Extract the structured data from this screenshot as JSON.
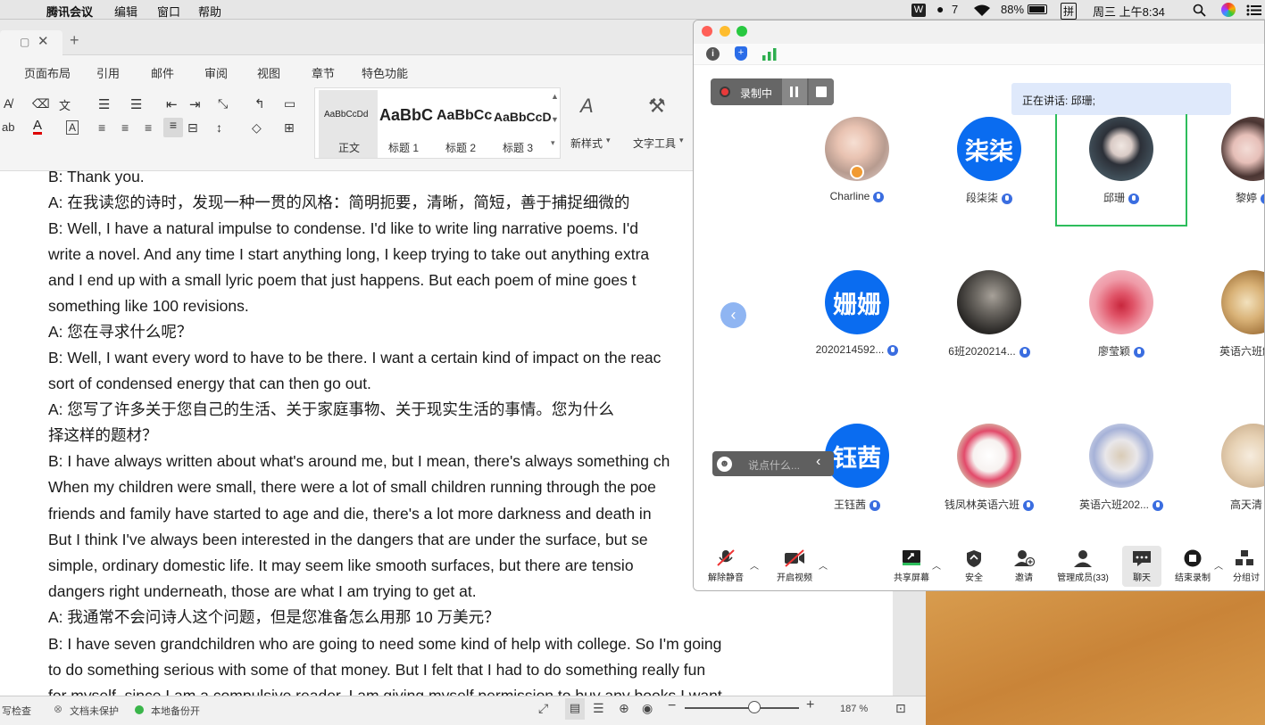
{
  "menubar": {
    "app_name": "腾讯会议",
    "menus": [
      "编辑",
      "窗口",
      "帮助"
    ],
    "notif_count": "7",
    "battery": "88%",
    "input_method": "拼",
    "datetime": "周三 上午8:34"
  },
  "word": {
    "ribbon_tabs": [
      "页面布局",
      "引用",
      "邮件",
      "审阅",
      "视图",
      "章节",
      "特色功能"
    ],
    "styles": [
      {
        "preview": "AaBbCcDd",
        "name": "正文"
      },
      {
        "preview": "AaBbC",
        "name": "标题 1"
      },
      {
        "preview": "AaBbCc",
        "name": "标题 2"
      },
      {
        "preview": "AaBbCcD",
        "name": "标题 3"
      }
    ],
    "new_style_label": "新样式",
    "text_tool_label": "文字工具",
    "doc_lines": [
      "B: Thank you.",
      "A:  在我读您的诗时，发现一种一贯的风格：简明扼要，清晰，简短，善于捕捉细微的",
      "B: Well, I have a natural impulse to condense. I'd like to write ling narrative poems. I'd",
      "write a novel. And any time I start anything long, I keep trying to take out anything extra",
      "and I end up with a small lyric poem that just happens. But each poem of mine goes t",
      "something like 100 revisions.",
      "A:  您在寻求什么呢？",
      "B: Well, I want every word to have to be there. I want a certain kind of impact on the reac",
      "sort of condensed energy that can then go out.",
      "A:  您写了许多关于您自己的生活、关于家庭事物、关于现实生活的事情。您为什么",
      "择这样的题材？",
      "B: I have always written about what's around me, but I mean, there's always something ch",
      "When my children were small, there were a lot of small children running through the poe",
      "friends and family have started to age and die, there's a lot more darkness and death in",
      "But I think I've always been interested in the dangers that are under the surface, but se",
      "simple, ordinary domestic life. It may seem like smooth surfaces, but there are tensio",
      "dangers right underneath, those are what I am trying to get at.",
      "A:  我通常不会问诗人这个问题，但是您准备怎么用那 10 万美元？",
      "B: I have seven grandchildren who are going to need some kind of help with college. So I'm going",
      "to do something serious with some of that money. But I felt that I had to do something really fun",
      "for myself, since I am a compulsive reader, I am giving myself permission to buy any books I want"
    ],
    "status": {
      "spell": "写检查",
      "protect": "文档未保护",
      "backup": "本地备份开",
      "zoom": "187 %"
    }
  },
  "meeting": {
    "recording_label": "录制中",
    "speaking_label": "正在讲话: 邱珊;",
    "chat_placeholder": "说点什么...",
    "participants": [
      {
        "name": "Charline",
        "avatar": "photo"
      },
      {
        "name": "段柒柒",
        "avatar": "text",
        "text": "柒柒"
      },
      {
        "name": "邱珊",
        "avatar": "photo",
        "active": true
      },
      {
        "name": "黎婷",
        "avatar": "photo"
      },
      {
        "name": "2020214592...",
        "avatar": "text",
        "text": "姗姗"
      },
      {
        "name": "6班2020214...",
        "avatar": "photo"
      },
      {
        "name": "廖莹颖",
        "avatar": "photo"
      },
      {
        "name": "英语六班解",
        "avatar": "photo"
      },
      {
        "name": "王钰茜",
        "avatar": "text",
        "text": "钰茜"
      },
      {
        "name": "钱凤林英语六班",
        "avatar": "photo"
      },
      {
        "name": "英语六班202...",
        "avatar": "photo"
      },
      {
        "name": "高天清",
        "avatar": "photo"
      }
    ],
    "toolbar": {
      "unmute": "解除静音",
      "video": "开启视频",
      "share": "共享屏幕",
      "security": "安全",
      "invite": "邀请",
      "members": "管理成员(33)",
      "chat": "聊天",
      "end_record": "结束录制",
      "breakout": "分组讨"
    }
  }
}
